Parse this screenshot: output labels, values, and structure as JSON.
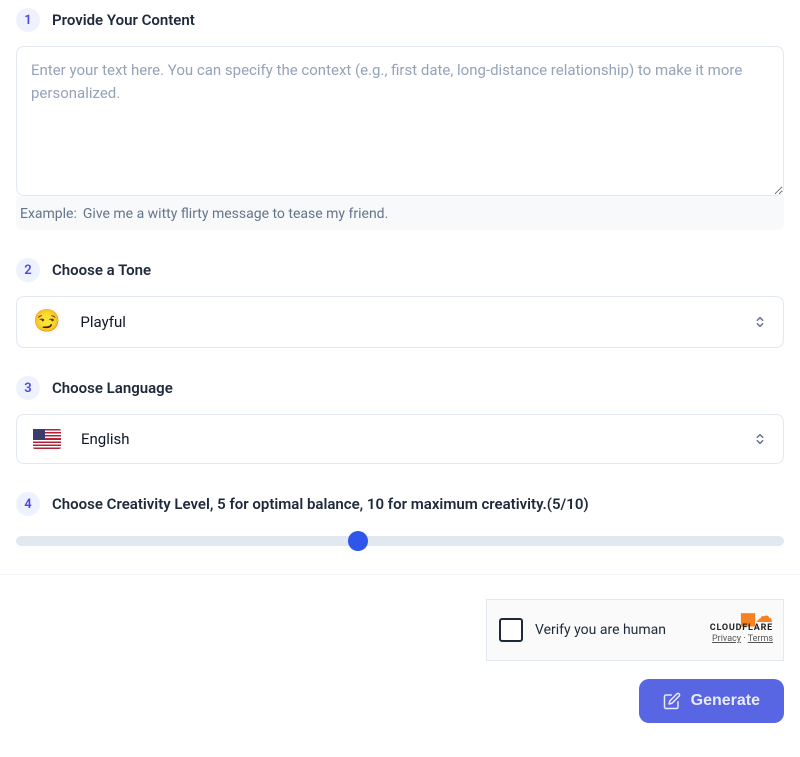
{
  "steps": {
    "content": {
      "number": "1",
      "title": "Provide Your Content",
      "placeholder": "Enter your text here. You can specify the context (e.g., first date, long-distance relationship) to make it more personalized.",
      "example_label": "Example:",
      "example_text": "Give me a witty flirty message to tease my friend."
    },
    "tone": {
      "number": "2",
      "title": "Choose a Tone",
      "icon": "😏",
      "selected": "Playful"
    },
    "language": {
      "number": "3",
      "title": "Choose Language",
      "selected": "English"
    },
    "creativity": {
      "number": "4",
      "title": "Choose Creativity Level, 5 for optimal balance, 10 for maximum creativity.(5/10)",
      "value": "5",
      "min": "1",
      "max": "10"
    }
  },
  "captcha": {
    "text": "Verify you are human",
    "brand": "CLOUDFLARE",
    "privacy": "Privacy",
    "terms": "Terms"
  },
  "actions": {
    "generate": "Generate"
  }
}
